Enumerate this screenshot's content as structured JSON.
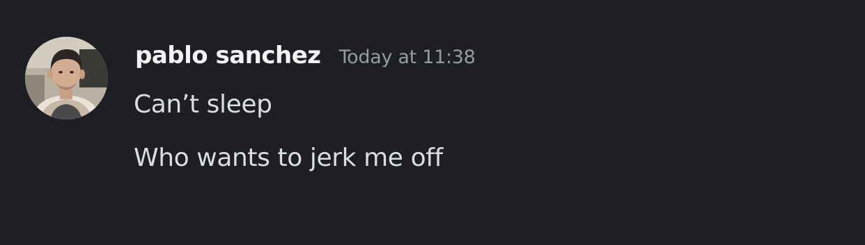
{
  "message_group": {
    "author": {
      "name": "pablo sanchez",
      "avatar_icon": "user-avatar-photo"
    },
    "timestamp": "Today at 11:38",
    "messages": [
      {
        "text": "Can’t sleep"
      },
      {
        "text": "Who wants to jerk me off"
      }
    ]
  },
  "colors": {
    "background": "#1e1f22",
    "username": "#f2f3f5",
    "timestamp": "#949ba4",
    "message_text": "#dbdee1"
  }
}
